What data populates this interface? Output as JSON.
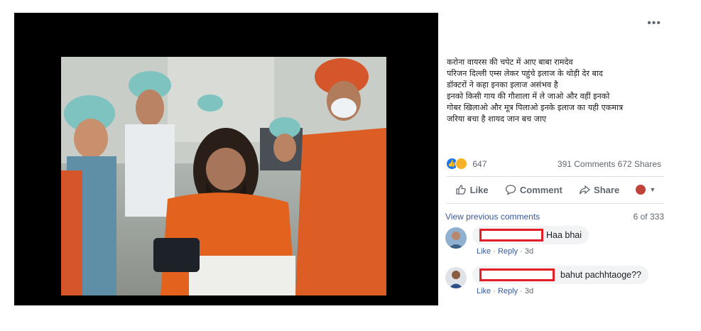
{
  "post": {
    "more_icon": "more-horizontal-icon",
    "more_label": "•••",
    "caption_lines": [
      "करोना वायरस की चपेट में आए बाबा रामदेव",
      "परिजन दिल्ली एम्स लेकर पहुंचे इलाज के थोड़ी देर बाद",
      "डॉक्टरों ने कहा इनका इलाज असंभव है",
      "इनको किसी गाय की गौशाला में ले जाओ और वहीं इनको",
      "गोबर खिलाओ और मूत्र पिलाओ इनके इलाज का यही एकमात्र",
      "जरिया बचा है शायद जान बच जाए"
    ],
    "reaction_count": "647",
    "comments_count": "391 Comments",
    "shares_count": "672 Shares"
  },
  "actions": {
    "like": "Like",
    "comment": "Comment",
    "share": "Share"
  },
  "comments": {
    "view_previous": "View previous comments",
    "range": "6 of 333",
    "items": [
      {
        "text": "Haa bhai",
        "like": "Like",
        "reply": "Reply",
        "time": "3d"
      },
      {
        "text": "bahut pachhtaoge??",
        "like": "Like",
        "reply": "Reply",
        "time": "3d"
      }
    ]
  },
  "colors": {
    "accent": "#1877f2",
    "link": "#385898",
    "redact": "#e41e26",
    "saffron": "#e2621e"
  }
}
